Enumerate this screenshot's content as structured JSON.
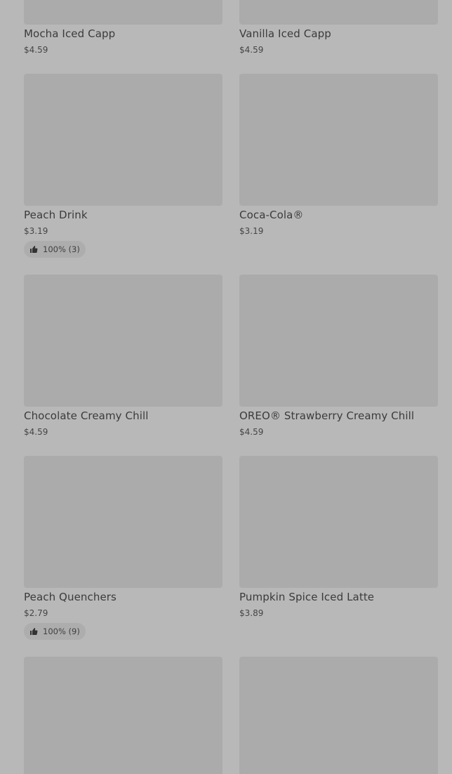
{
  "products": [
    {
      "name": "Mocha Iced Capp",
      "price": "$4.59",
      "rating": ""
    },
    {
      "name": "Vanilla Iced Capp",
      "price": "$4.59",
      "rating": ""
    },
    {
      "name": "Peach Drink",
      "price": "$3.19",
      "rating": "100% (3)"
    },
    {
      "name": "Coca-Cola®",
      "price": "$3.19",
      "rating": ""
    },
    {
      "name": "Chocolate Creamy Chill",
      "price": "$4.59",
      "rating": ""
    },
    {
      "name": "OREO® Strawberry Creamy Chill",
      "price": "$4.59",
      "rating": ""
    },
    {
      "name": "Peach Quenchers",
      "price": "$2.79",
      "rating": "100% (9)"
    },
    {
      "name": "Pumpkin Spice Iced Latte",
      "price": "$3.89",
      "rating": ""
    },
    {
      "name": "",
      "price": "",
      "rating": ""
    },
    {
      "name": "",
      "price": "",
      "rating": ""
    }
  ],
  "icons": {
    "rating": "thumbs-up-icon"
  }
}
